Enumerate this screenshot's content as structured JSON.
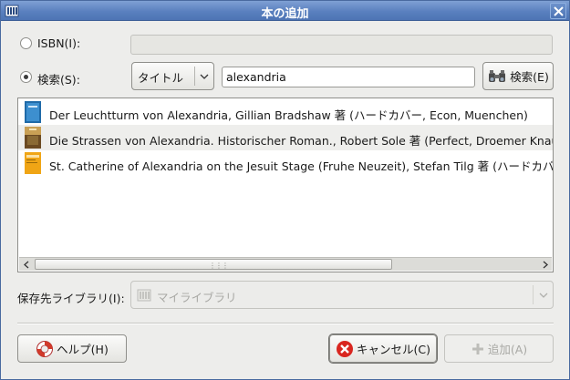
{
  "window": {
    "title": "本の追加",
    "close_icon": "close-icon"
  },
  "isbn": {
    "label": "ISBN(I):",
    "value": ""
  },
  "search": {
    "label": "検索(S):",
    "field_option": "タイトル",
    "query": "alexandria",
    "button_label": "検索(E)"
  },
  "results": [
    {
      "text": "Der Leuchtturm von Alexandria, Gillian Bradshaw 著 (ハードカバー, Econ, Muenchen)",
      "cover": "blue"
    },
    {
      "text": "Die Strassen von Alexandria. Historischer Roman., Robert Sole 著 (Perfect, Droemer Knaur)",
      "cover": "photo"
    },
    {
      "text": "St. Catherine of Alexandria on the Jesuit Stage (Fruhe Neuzeit), Stefan Tilg 著 (ハードカバー)",
      "cover": "yellow"
    }
  ],
  "destination": {
    "label": "保存先ライブラリ(I):",
    "value": "マイライブラリ"
  },
  "buttons": {
    "help": "ヘルプ(H)",
    "cancel": "キャンセル(C)",
    "add": "追加(A)"
  },
  "colors": {
    "titlebar": "#5a80bf",
    "selected_row": "#eeeeec",
    "cancel_icon": "#d9261f"
  }
}
